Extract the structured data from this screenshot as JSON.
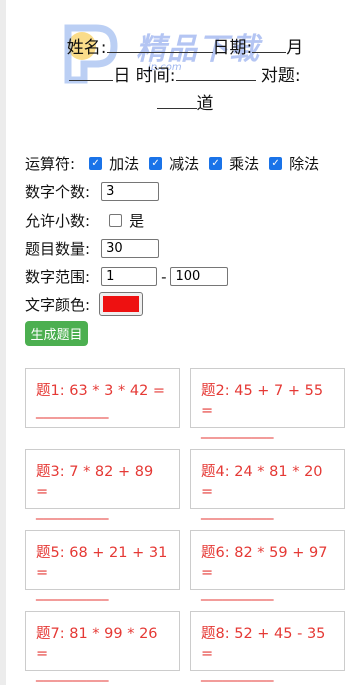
{
  "header": {
    "name_label": "姓名:",
    "date_label": "日期:",
    "month_label": "月",
    "day_label": "日",
    "time_label": "时间:",
    "correct_label": "对题:",
    "unit_label": "道"
  },
  "watermark": {
    "brand_text": "精品下载",
    "url_text": "jp.com"
  },
  "settings": {
    "operators_label": "运算符:",
    "operators": [
      {
        "label": "加法",
        "checked": true
      },
      {
        "label": "减法",
        "checked": true
      },
      {
        "label": "乘法",
        "checked": true
      },
      {
        "label": "除法",
        "checked": true
      }
    ],
    "digit_count_label": "数字个数:",
    "digit_count_value": "3",
    "allow_decimal_label": "允许小数:",
    "allow_decimal_checked": false,
    "allow_decimal_option": "是",
    "question_count_label": "题目数量:",
    "question_count_value": "30",
    "range_label": "数字范围:",
    "range_min": "1",
    "range_separator": "-",
    "range_max": "100",
    "text_color_label": "文字颜色:",
    "text_color": "#ee1111",
    "generate_button": "生成题目"
  },
  "colors": {
    "question_text": "#e53935",
    "button_bg": "#4caf50"
  },
  "questions": [
    {
      "prefix": "题1:",
      "expr": "63 * 3 * 42 =",
      "blank": "__________"
    },
    {
      "prefix": "题2:",
      "expr": "45 + 7 + 55 =",
      "blank": "__________"
    },
    {
      "prefix": "题3:",
      "expr": "7 * 82 + 89 =",
      "blank": "__________"
    },
    {
      "prefix": "题4:",
      "expr": "24 * 81 * 20 =",
      "blank": "__________"
    },
    {
      "prefix": "题5:",
      "expr": "68 + 21 + 31 =",
      "blank": "__________"
    },
    {
      "prefix": "题6:",
      "expr": "82 * 59 + 97 =",
      "blank": "__________"
    },
    {
      "prefix": "题7:",
      "expr": "81 * 99 * 26 =",
      "blank": "__________"
    },
    {
      "prefix": "题8:",
      "expr": "52 + 45 - 35 =",
      "blank": "__________"
    }
  ]
}
